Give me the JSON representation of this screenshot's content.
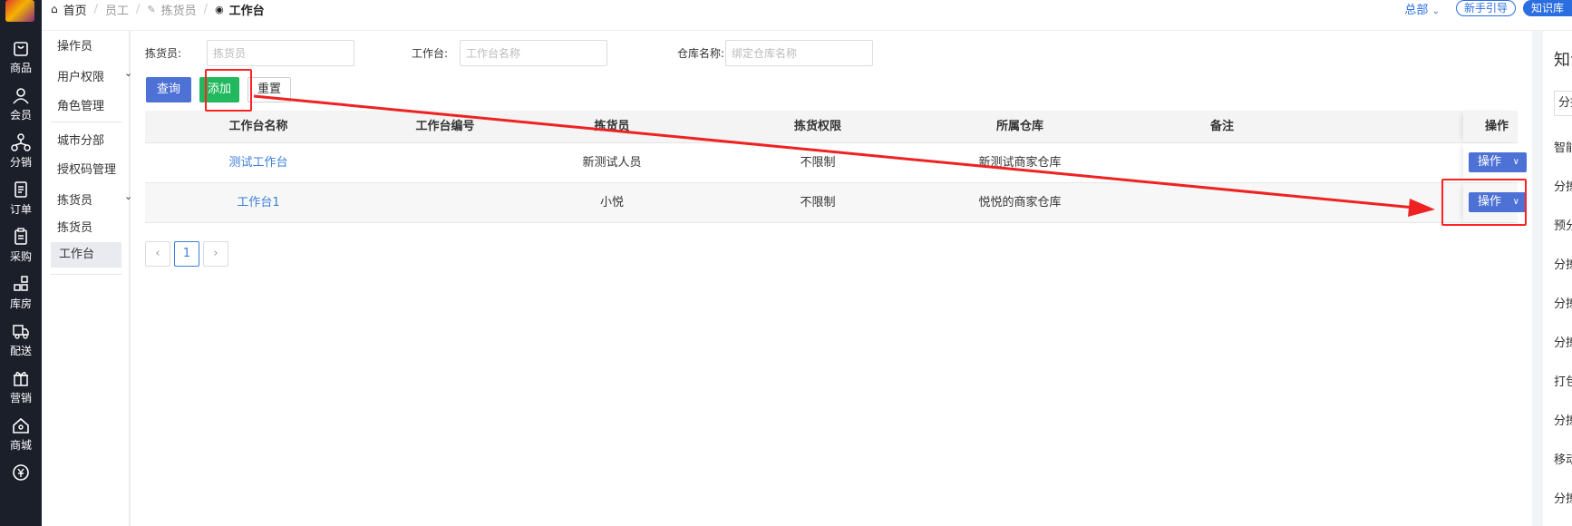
{
  "topbar": {
    "breadcrumb": [
      "首页",
      "员工",
      "拣货员",
      "工作台"
    ],
    "region": "总部",
    "guide_btn": "新手引导",
    "kb_btn": "知识库"
  },
  "leftnav": [
    "商品",
    "会员",
    "分销",
    "订单",
    "采购",
    "库房",
    "配送",
    "营销",
    "商城"
  ],
  "submenu": {
    "operator": "操作员",
    "user_perm": "用户权限",
    "role_mgmt": "角色管理",
    "city_branch": "城市分部",
    "auth_code": "授权码管理",
    "picker_group": "拣货员",
    "picker": "拣货员",
    "workbench": "工作台"
  },
  "filters": {
    "picker_label": "拣货员:",
    "picker_placeholder": "拣货员",
    "bench_label": "工作台:",
    "bench_placeholder": "工作台名称",
    "warehouse_label": "仓库名称:",
    "warehouse_placeholder": "绑定仓库名称"
  },
  "buttons": {
    "query": "查询",
    "add": "添加",
    "reset": "重置"
  },
  "table": {
    "headers": [
      "工作台名称",
      "工作台编号",
      "拣货员",
      "拣货权限",
      "所属仓库",
      "备注",
      "操作"
    ],
    "rows": [
      {
        "name": "测试工作台",
        "code": "",
        "picker": "新测试人员",
        "perm": "不限制",
        "warehouse": "新测试商家仓库",
        "note": "",
        "op": "操作"
      },
      {
        "name": "工作台1",
        "code": "",
        "picker": "小悦",
        "perm": "不限制",
        "warehouse": "悦悦的商家仓库",
        "note": "",
        "op": "操作"
      }
    ]
  },
  "pagination": {
    "prev": "‹",
    "current": "1",
    "next": "›"
  },
  "right_panel": {
    "title": "知识库",
    "search": "分拣",
    "items": [
      "智能",
      "分拣",
      "预分",
      "分拣",
      "分拣",
      "分拣",
      "打包",
      "分拣",
      "移动",
      "分拣"
    ]
  },
  "colors": {
    "primary": "#4e71d6",
    "add": "#21b85e",
    "link": "#3c7fd9",
    "annotation": "#ff2222"
  }
}
